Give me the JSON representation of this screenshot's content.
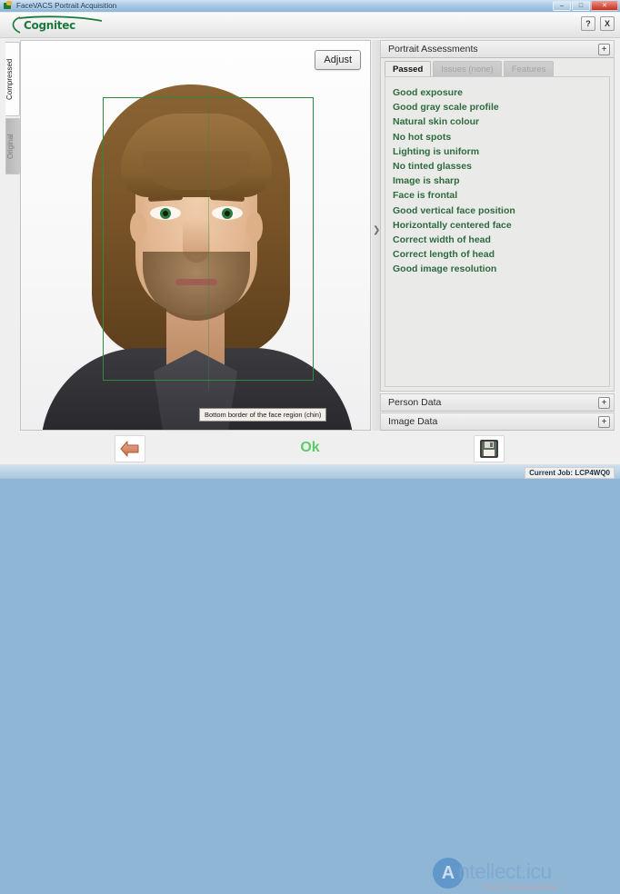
{
  "window": {
    "title": "FaceVACS Portrait Acquisition",
    "minimize_label": "–",
    "maximize_label": "□",
    "close_label": "✕"
  },
  "header": {
    "brand": "Cognitec",
    "help_label": "?",
    "close_label": "X"
  },
  "viewer": {
    "tabs": [
      {
        "label": "Compressed",
        "state": "active"
      },
      {
        "label": "Original",
        "state": "inactive"
      }
    ],
    "adjust_label": "Adjust",
    "chin_tooltip": "Bottom border of the face region (chin)",
    "face_rect_color": "#2f8a3d"
  },
  "splitter": {
    "grip_glyph": "❯"
  },
  "assessments": {
    "section_title": "Portrait Assessments",
    "expander_label": "+",
    "tabs": [
      {
        "label": "Passed",
        "state": "active"
      },
      {
        "label": "Issues (none)",
        "state": "disabled"
      },
      {
        "label": "Features",
        "state": "disabled"
      }
    ],
    "text_color": "#2e6b3f",
    "items": [
      "Good exposure",
      "Good gray scale profile",
      "Natural skin colour",
      "No hot spots",
      "Lighting is uniform",
      "No tinted glasses",
      "Image is sharp",
      "Face is frontal",
      "Good vertical face position",
      "Horizontally centered face",
      "Correct width of head",
      "Correct length of head",
      "Good image resolution"
    ]
  },
  "person_data": {
    "title": "Person Data",
    "expander_label": "+"
  },
  "image_data": {
    "title": "Image Data",
    "expander_label": "+"
  },
  "bottom": {
    "status_text": "Ok",
    "status_color": "#5ecb6b",
    "back_icon": "back-arrow-icon",
    "save_icon": "save-floppy-icon"
  },
  "watermark": {
    "mark": "A",
    "text": "ntellect.icu",
    "subtitle": "Искусственный разум"
  },
  "status_bar": {
    "current_job": "Current Job: LCP4WQ0"
  }
}
